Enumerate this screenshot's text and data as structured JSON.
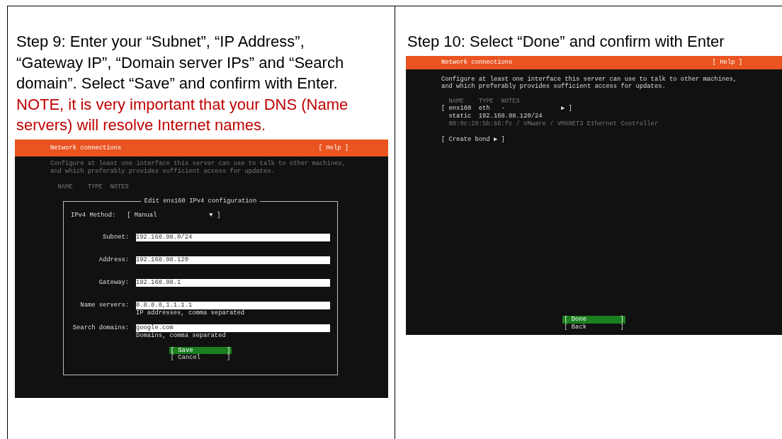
{
  "steps": [
    {
      "title": "Step 9: Enter your “Subnet”, “IP Address”, “Gateway IP”, “Domain server IPs” and “Search domain”. Select “Save” and confirm with Enter.",
      "note": "NOTE, it is very important that your DNS (Name servers) will resolve Internet names.",
      "terminal": {
        "header": "Network connections",
        "help": "[ Help ]",
        "description": [
          "Configure at least one interface this server can use to talk to other machines,",
          "and which preferably provides sufficient access for updates."
        ],
        "dimmed": true,
        "lines": [
          {
            "kind": "heading",
            "text": "NAME    TYPE  NOTES"
          }
        ],
        "dialog": {
          "title": "Edit ens160 IPv4 configuration",
          "method_label": "IPv4 Method:",
          "method_value": "[ Manual              ▼ ]",
          "fields": [
            {
              "label": "Subnet:",
              "value": "192.168.98.0/24"
            },
            {
              "label": "Address:",
              "value": "192.168.98.120"
            },
            {
              "label": "Gateway:",
              "value": "192.168.98.1"
            },
            {
              "label": "Name servers:",
              "value": "8.8.8.8,1.1.1.1",
              "hint": "IP addresses, comma separated"
            },
            {
              "label": "Search domains:",
              "value": "google.com",
              "hint": "Domains, comma separated"
            }
          ]
        },
        "buttons": [
          {
            "label": "[ Save         ]",
            "selected": true
          },
          {
            "label": "[ Cancel       ]",
            "selected": false
          }
        ]
      }
    },
    {
      "title": "Step 10: Select “Done” and confirm with Enter",
      "terminal": {
        "header": "Network connections",
        "help": "[ Help ]",
        "description": [
          "Configure at least one interface this server can use to talk to other machines,",
          "and which preferably provides sufficient access for updates."
        ],
        "dimmed": false,
        "lines": [
          {
            "kind": "heading",
            "text": "NAME    TYPE  NOTES"
          },
          {
            "kind": "item",
            "text": "[ ens160  eth   -               ▶ ]"
          },
          {
            "kind": "detail",
            "text": "static  192.168.98.120/24"
          },
          {
            "kind": "hardware",
            "text": "00:0c:29:5b:66:fc / VMware / VMXNET3 Ethernet Controller"
          },
          {
            "kind": "action",
            "text": "[ Create bond ▶ ]"
          }
        ],
        "buttons": [
          {
            "label": "[ Done         ]",
            "selected": true
          },
          {
            "label": "[ Back         ]",
            "selected": false
          }
        ]
      }
    }
  ]
}
